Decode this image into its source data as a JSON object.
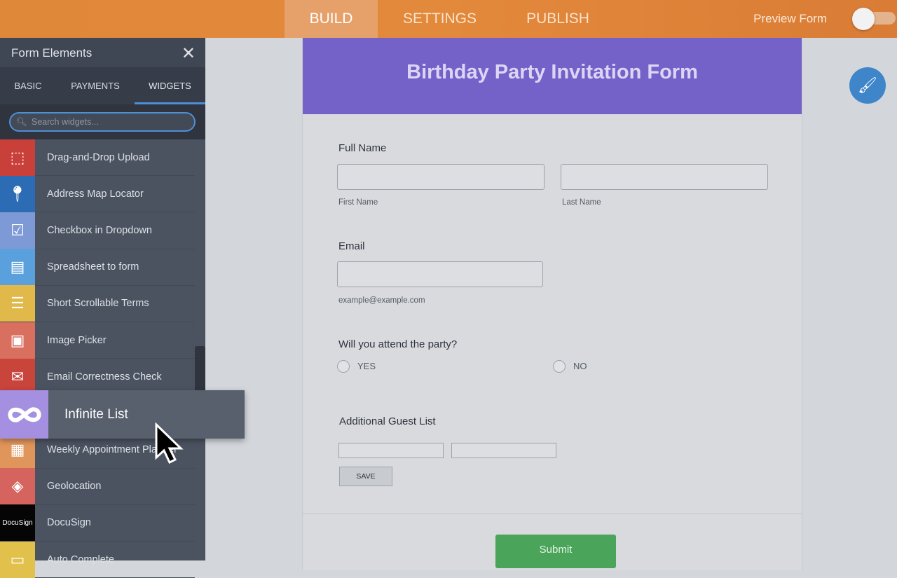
{
  "topbar": {
    "tabs": [
      "BUILD",
      "SETTINGS",
      "PUBLISH"
    ],
    "active": "BUILD",
    "preview_label": "Preview Form",
    "preview_on": false
  },
  "sidebar": {
    "title": "Form Elements",
    "tabs": [
      "BASIC",
      "PAYMENTS",
      "WIDGETS"
    ],
    "active_tab": "WIDGETS",
    "search_placeholder": "Search widgets...",
    "items": [
      {
        "label": "Drag-and-Drop Upload",
        "color": "#c9403b",
        "icon": "upload-icon"
      },
      {
        "label": "Address Map Locator",
        "color": "#2b6cb4",
        "icon": "map-pin-icon"
      },
      {
        "label": "Checkbox in Dropdown",
        "color": "#7e9ad6",
        "icon": "checklist-icon"
      },
      {
        "label": "Spreadsheet to form",
        "color": "#5aa0dc",
        "icon": "spreadsheet-icon"
      },
      {
        "label": "Short Scrollable Terms",
        "color": "#e0b94a",
        "icon": "terms-icon"
      },
      {
        "label": "Image Picker",
        "color": "#d9705f",
        "icon": "image-icon"
      },
      {
        "label": "Email Correctness Check",
        "color": "#c9453c",
        "icon": "email-icon"
      },
      {
        "label": "",
        "color": "#4b5361",
        "icon": ""
      },
      {
        "label": "Weekly Appointment Planner",
        "color": "#e0955a",
        "icon": "calendar-icon"
      },
      {
        "label": "Geolocation",
        "color": "#d5645f",
        "icon": "map-icon"
      },
      {
        "label": "DocuSign",
        "color": "#050505",
        "icon": "docusign-logo",
        "logo_text": "DocuSign"
      },
      {
        "label": "Auto Complete",
        "color": "#e1c04c",
        "icon": "autocomplete-icon"
      }
    ],
    "dragging": {
      "label": "Infinite List",
      "color": "#a48fe0",
      "icon": "infinity-icon"
    }
  },
  "form": {
    "title": "Birthday Party Invitation Form",
    "full_name": {
      "label": "Full Name",
      "first": "First Name",
      "last": "Last Name"
    },
    "email": {
      "label": "Email",
      "hint": "example@example.com"
    },
    "attend": {
      "label": "Will you attend the party?",
      "options": [
        "YES",
        "NO"
      ]
    },
    "guests": {
      "label": "Additional Guest List",
      "save": "SAVE"
    },
    "submit": "Submit"
  }
}
